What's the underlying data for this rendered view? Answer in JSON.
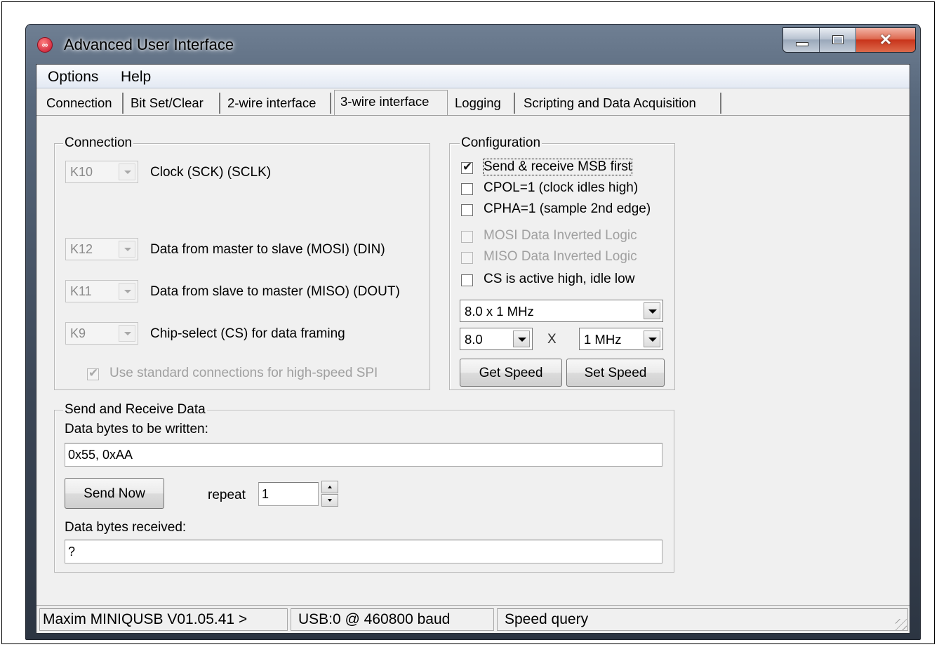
{
  "window": {
    "title": "Advanced User Interface",
    "icon": "maxim-logo-icon"
  },
  "menu": {
    "items": [
      "Options",
      "Help"
    ]
  },
  "tabs": [
    {
      "label": "Connection"
    },
    {
      "label": "Bit Set/Clear"
    },
    {
      "label": "2-wire interface"
    },
    {
      "label": "3-wire interface",
      "active": true
    },
    {
      "label": "Logging"
    },
    {
      "label": "Scripting and Data Acquisition"
    }
  ],
  "connection": {
    "title": "Connection",
    "rows": [
      {
        "pin": "K10",
        "label": "Clock (SCK) (SCLK)"
      },
      {
        "pin": "K12",
        "label": "Data from master to slave (MOSI) (DIN)"
      },
      {
        "pin": "K11",
        "label": "Data from slave to master (MISO) (DOUT)"
      },
      {
        "pin": "K9",
        "label": "Chip-select (CS) for data framing"
      }
    ],
    "std_label": "Use standard connections for high-speed SPI",
    "std_checked": true
  },
  "configuration": {
    "title": "Configuration",
    "options": [
      {
        "label": "Send & receive MSB first",
        "checked": true,
        "enabled": true
      },
      {
        "label": "CPOL=1 (clock idles high)",
        "checked": false,
        "enabled": true
      },
      {
        "label": "CPHA=1 (sample 2nd edge)",
        "checked": false,
        "enabled": true
      },
      {
        "label": "MOSI Data Inverted Logic",
        "checked": false,
        "enabled": false
      },
      {
        "label": "MISO Data Inverted Logic",
        "checked": false,
        "enabled": false
      },
      {
        "label": "CS is active high, idle low",
        "checked": false,
        "enabled": true
      }
    ],
    "speed_select": "8.0 x 1 MHz",
    "multiplier": "8.0",
    "times": "X",
    "base": "1 MHz",
    "get_speed": "Get Speed",
    "set_speed": "Set Speed"
  },
  "send_receive": {
    "title": "Send and Receive Data",
    "write_label": "Data bytes to be written:",
    "write_value": "0x55, 0xAA",
    "send_now": "Send Now",
    "repeat_label": "repeat",
    "repeat_value": "1",
    "received_label": "Data bytes received:",
    "received_value": "?"
  },
  "status": {
    "panels": [
      "Maxim MINIQUSB V01.05.41 >",
      "USB:0 @ 460800 baud",
      "Speed query"
    ]
  }
}
